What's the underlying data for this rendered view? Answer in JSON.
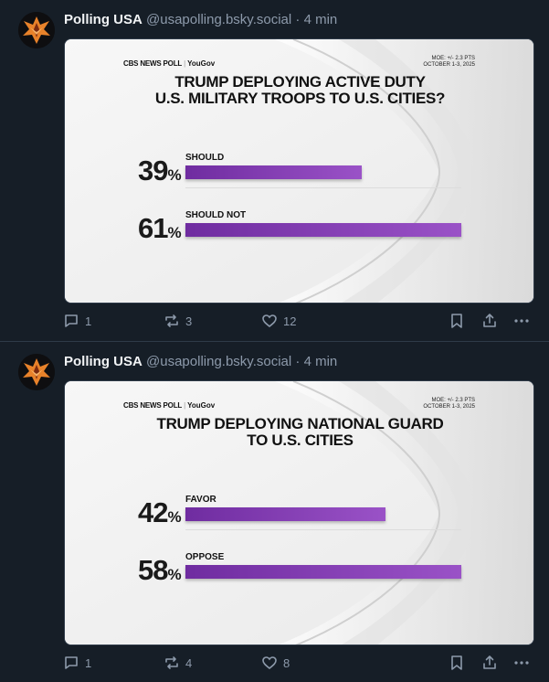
{
  "posts": [
    {
      "author": "Polling USA",
      "handle": "@usapolling.bsky.social",
      "separator": "·",
      "time": "4 min",
      "card": {
        "logo_cbs": "CBS NEWS POLL",
        "logo_yougov": "YouGov",
        "moe_line1": "MOE: +/- 2.3 PTS",
        "moe_line2": "OCTOBER 1-3, 2025",
        "title_line1": "TRUMP DEPLOYING ACTIVE DUTY",
        "title_line2": "U.S. MILITARY TROOPS TO U.S. CITIES?",
        "results": [
          {
            "label": "SHOULD",
            "value": 39,
            "number": "39",
            "pct": "%"
          },
          {
            "label": "SHOULD NOT",
            "value": 61,
            "number": "61",
            "pct": "%"
          }
        ]
      },
      "actions": {
        "replies": "1",
        "reposts": "3",
        "likes": "12"
      }
    },
    {
      "author": "Polling USA",
      "handle": "@usapolling.bsky.social",
      "separator": "·",
      "time": "4 min",
      "card": {
        "logo_cbs": "CBS NEWS POLL",
        "logo_yougov": "YouGov",
        "moe_line1": "MOE: +/- 2.3 PTS",
        "moe_line2": "OCTOBER 1-3, 2025",
        "title_line1": "TRUMP DEPLOYING NATIONAL GUARD",
        "title_line2": "TO U.S. CITIES",
        "results": [
          {
            "label": "FAVOR",
            "value": 42,
            "number": "42",
            "pct": "%"
          },
          {
            "label": "OPPOSE",
            "value": 58,
            "number": "58",
            "pct": "%"
          }
        ]
      },
      "actions": {
        "replies": "1",
        "reposts": "4",
        "likes": "8"
      }
    }
  ],
  "icons": {
    "reply": "speech-bubble-icon",
    "repost": "repost-arrows-icon",
    "like": "heart-icon",
    "bookmark": "bookmark-icon",
    "share": "share-icon",
    "more": "more-dots-icon"
  },
  "colors": {
    "background": "#161e27",
    "muted_text": "#8d9aab",
    "bar_purple": "#7b34ad",
    "avatar_orange": "#e8822a"
  }
}
